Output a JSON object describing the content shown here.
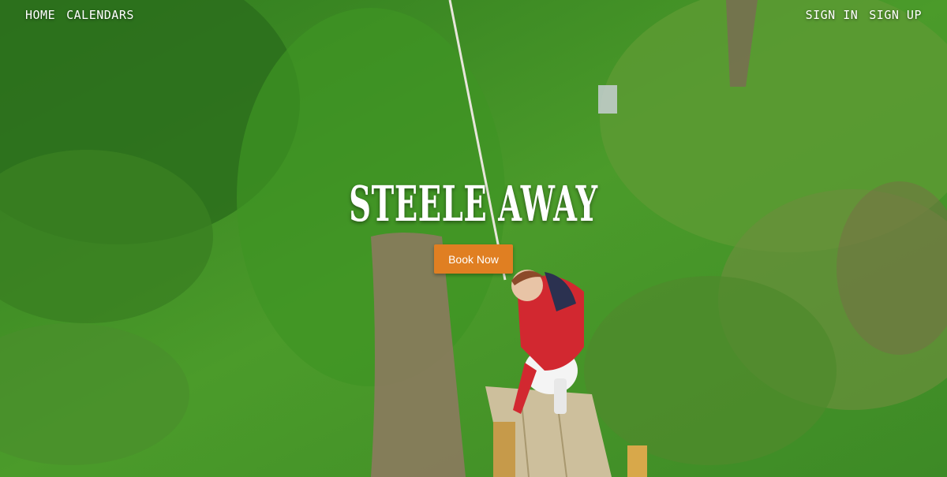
{
  "nav": {
    "left": [
      {
        "label": "HOME"
      },
      {
        "label": "CALENDARS"
      }
    ],
    "right": [
      {
        "label": "SIGN IN"
      },
      {
        "label": "SIGN UP"
      }
    ]
  },
  "hero": {
    "title": "STEELE AWAY",
    "cta_label": "Book Now",
    "cta_color": "#e07f22"
  }
}
